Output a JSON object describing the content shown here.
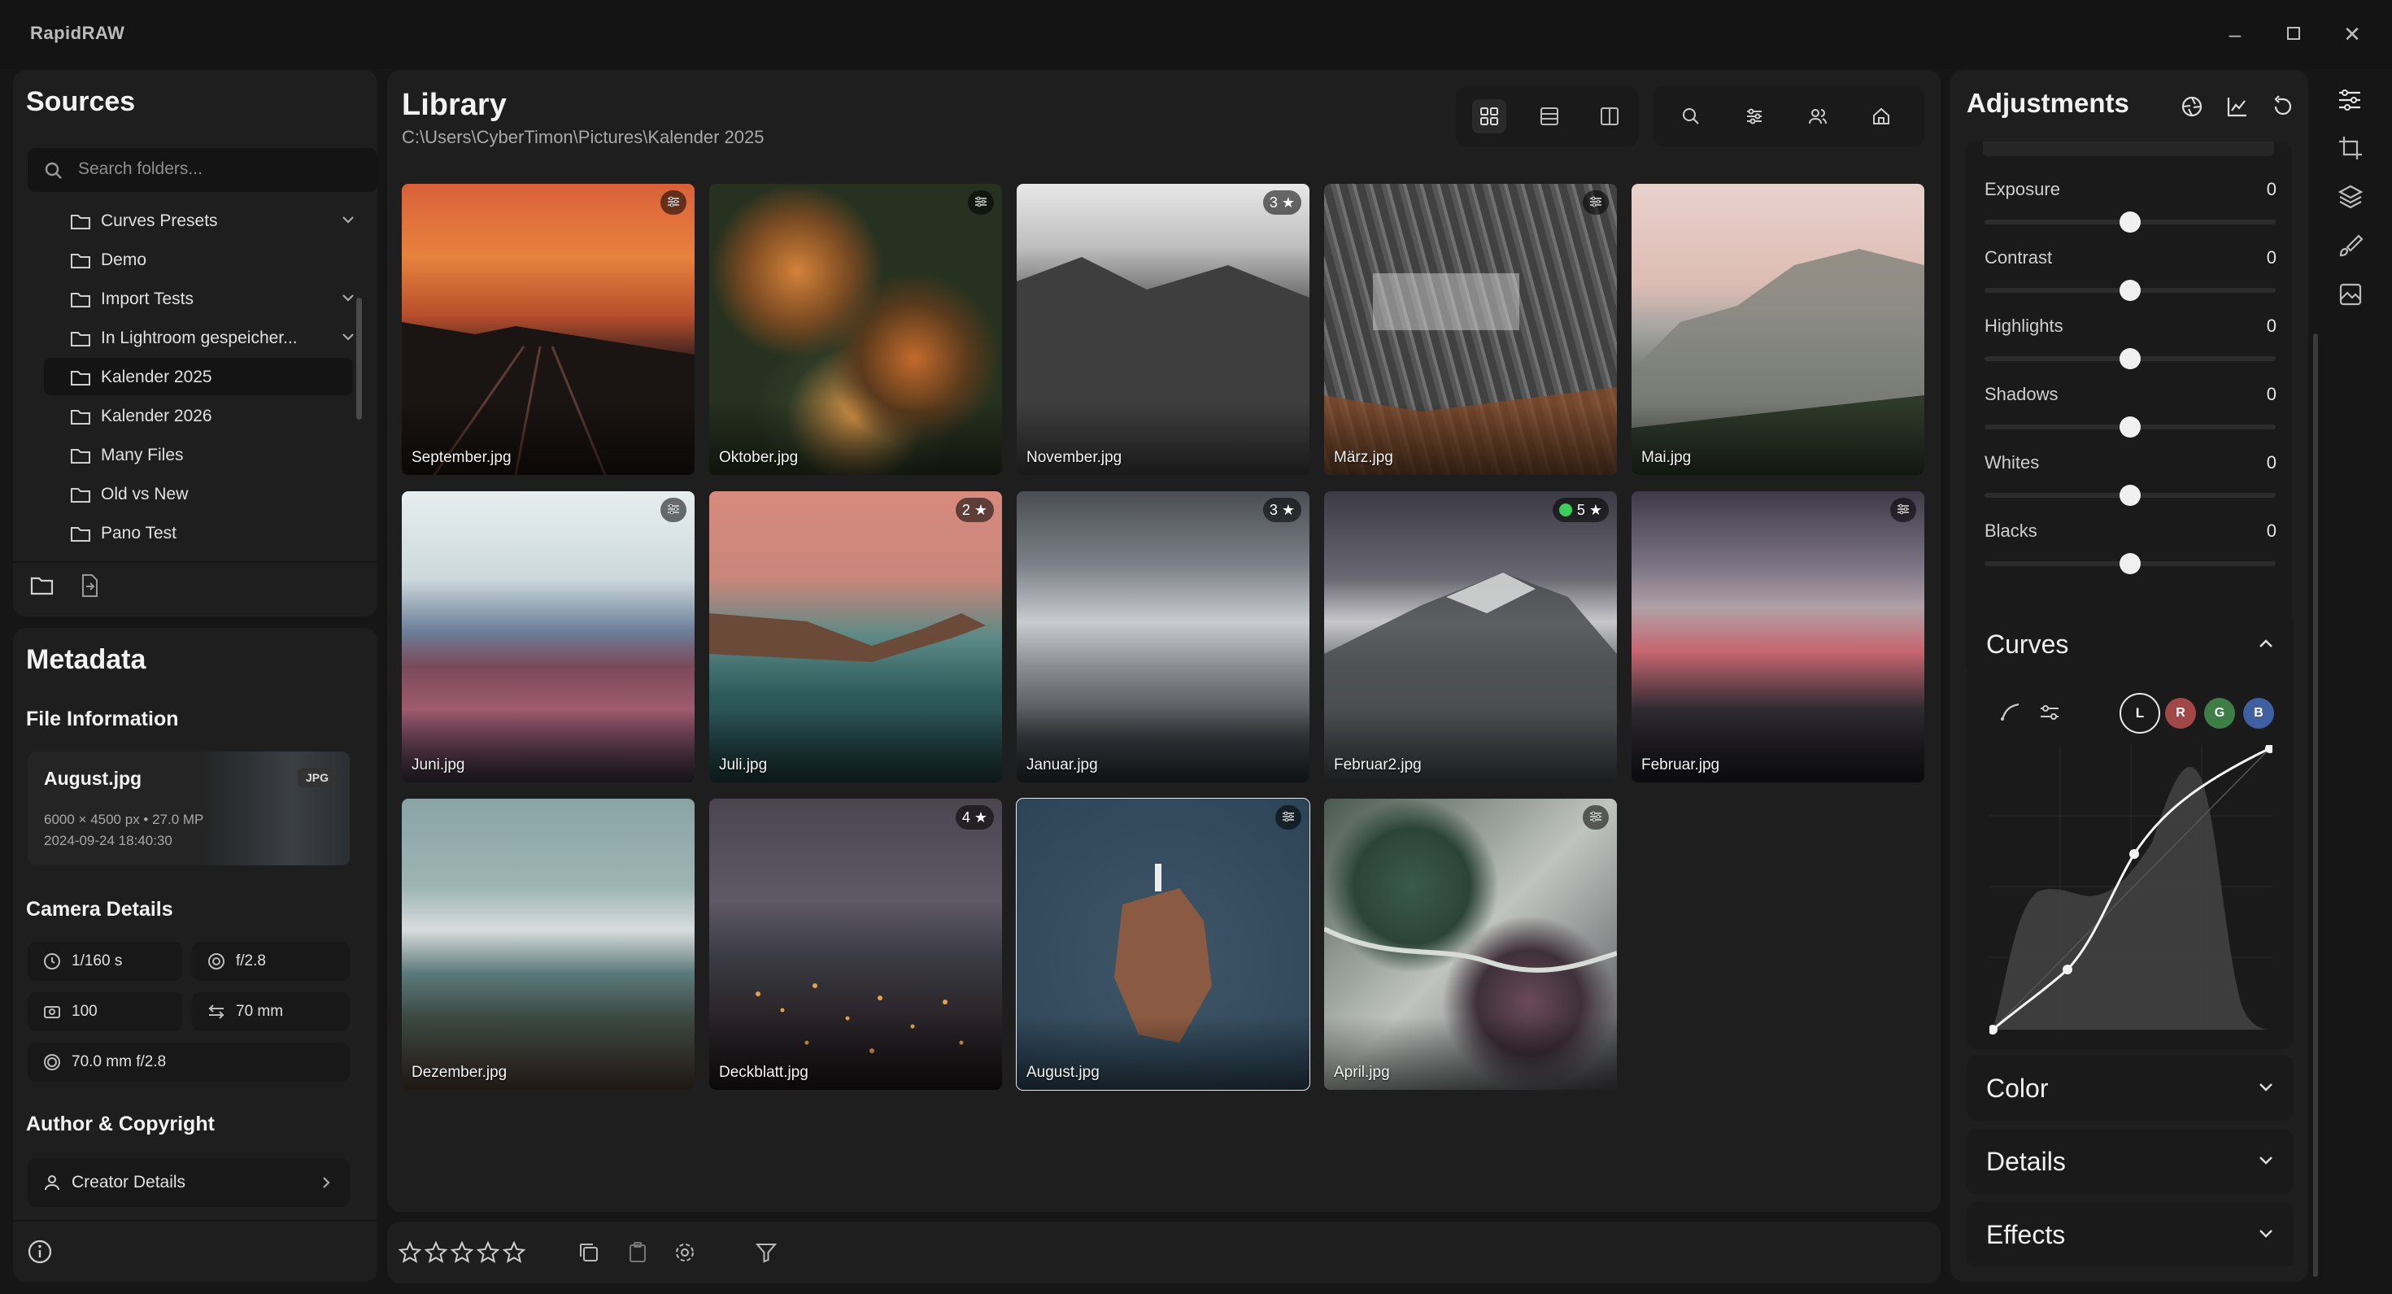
{
  "app": {
    "title": "RapidRAW"
  },
  "sources": {
    "title": "Sources",
    "search_placeholder": "Search folders...",
    "folders": [
      {
        "label": "Curves Presets",
        "expandable": true
      },
      {
        "label": "Demo",
        "expandable": false
      },
      {
        "label": "Import Tests",
        "expandable": true
      },
      {
        "label": "In Lightroom gespeicher...",
        "expandable": true
      },
      {
        "label": "Kalender 2025",
        "expandable": false,
        "active": true
      },
      {
        "label": "Kalender 2026",
        "expandable": false
      },
      {
        "label": "Many Files",
        "expandable": false
      },
      {
        "label": "Old vs New",
        "expandable": false
      },
      {
        "label": "Pano Test",
        "expandable": false
      }
    ]
  },
  "metadata": {
    "title": "Metadata",
    "file_info_title": "File Information",
    "file_name": "August.jpg",
    "file_type": "JPG",
    "dimensions": "6000 × 4500 px • 27.0 MP",
    "datetime": "2024-09-24 18:40:30",
    "camera_title": "Camera Details",
    "shutter": "1/160 s",
    "aperture": "f/2.8",
    "iso": "100",
    "focal": "70 mm",
    "lens": "70.0 mm f/2.8",
    "author_title": "Author & Copyright",
    "creator_label": "Creator Details"
  },
  "library": {
    "title": "Library",
    "path": "C:\\Users\\CyberTimon\\Pictures\\Kalender 2025",
    "images": [
      {
        "name": "September.jpg",
        "badge": "adjust"
      },
      {
        "name": "Oktober.jpg",
        "badge": "adjust"
      },
      {
        "name": "November.jpg",
        "badge": "3 ★"
      },
      {
        "name": "März.jpg",
        "badge": "adjust"
      },
      {
        "name": "Mai.jpg",
        "badge": ""
      },
      {
        "name": "Juni.jpg",
        "badge": "adjust"
      },
      {
        "name": "Juli.jpg",
        "badge": "2 ★"
      },
      {
        "name": "Januar.jpg",
        "badge": "3 ★"
      },
      {
        "name": "Februar2.jpg",
        "badge": "5 ★",
        "color_tag": "#3ecf5a"
      },
      {
        "name": "Februar.jpg",
        "badge": "adjust"
      },
      {
        "name": "Dezember.jpg",
        "badge": ""
      },
      {
        "name": "Deckblatt.jpg",
        "badge": "4 ★"
      },
      {
        "name": "August.jpg",
        "badge": "adjust",
        "selected": true
      },
      {
        "name": "April.jpg",
        "badge": "adjust"
      }
    ]
  },
  "adjustments": {
    "title": "Adjustments",
    "sliders": [
      {
        "label": "Exposure",
        "value": "0"
      },
      {
        "label": "Contrast",
        "value": "0"
      },
      {
        "label": "Highlights",
        "value": "0"
      },
      {
        "label": "Shadows",
        "value": "0"
      },
      {
        "label": "Whites",
        "value": "0"
      },
      {
        "label": "Blacks",
        "value": "0"
      }
    ],
    "curves_title": "Curves",
    "channels": [
      "L",
      "R",
      "G",
      "B"
    ],
    "sections": [
      "Color",
      "Details",
      "Effects"
    ]
  },
  "colors": {
    "accent": "#eaeaea",
    "panel": "#1e1e1e",
    "green_tag": "#3ecf5a",
    "channel_r": "#a04848",
    "channel_g": "#3f7d46",
    "channel_b": "#3f5fa0"
  }
}
